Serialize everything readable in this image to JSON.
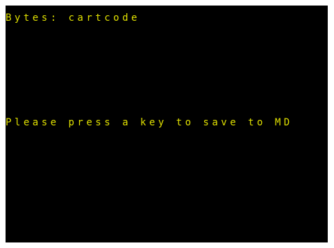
{
  "screen": {
    "background": "#000000",
    "text_color": "#e0e000",
    "lines": [
      "Bytes: cartcode",
      "Please press a key to save to MD"
    ]
  }
}
